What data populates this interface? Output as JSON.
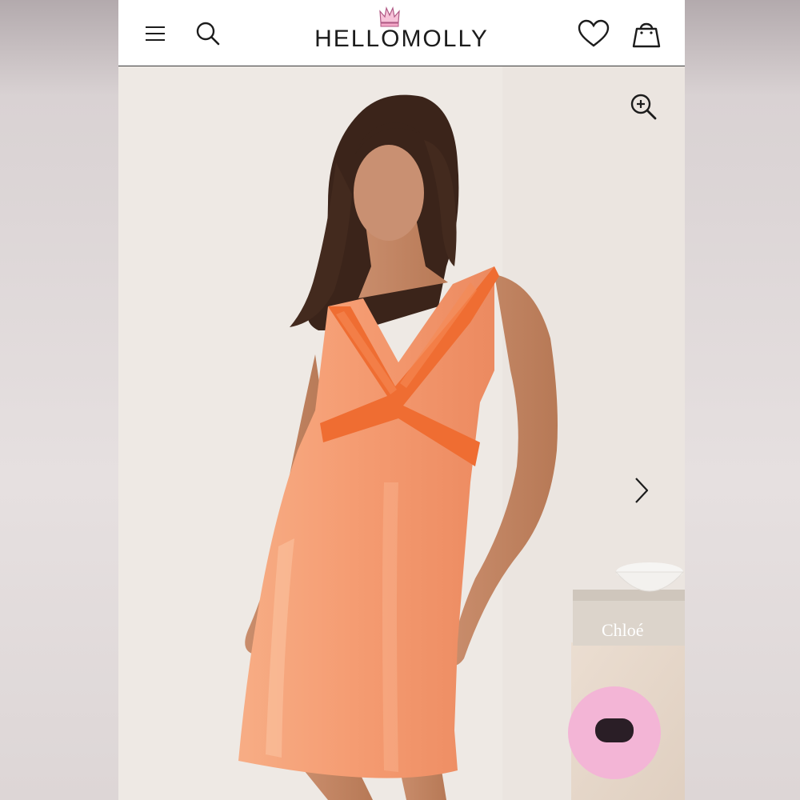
{
  "header": {
    "logo_text": "HELLOMOLLY",
    "icons": [
      "menu-icon",
      "search-icon",
      "crown-icon",
      "heart-icon",
      "bag-icon"
    ]
  },
  "product_image": {
    "controls": [
      "zoom-in-icon",
      "chevron-right-icon"
    ],
    "props_text": "Chloé"
  },
  "colors": {
    "header_bg": "#ffffff",
    "dress": "#f39a72",
    "lace": "#ee6a2f",
    "chat_bubble": "#f3b5d6"
  }
}
